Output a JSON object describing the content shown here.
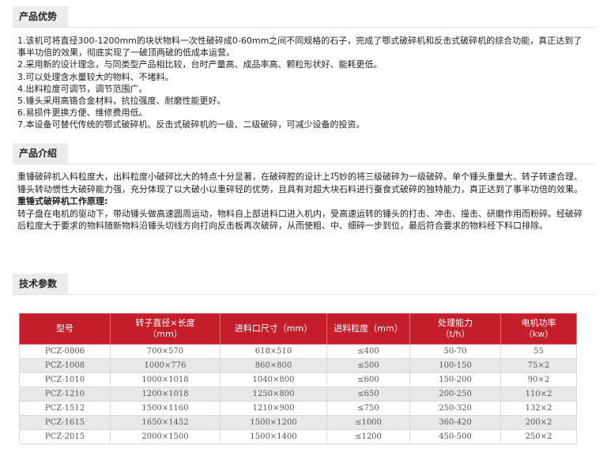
{
  "sections": {
    "advantages_title": "产品优势",
    "intro_title": "产品介绍",
    "params_title": "技术参数"
  },
  "advantages": [
    "1.该机可将直径300-1200mm的块状物料一次性破碎成0-60mm之间不同规格的石子，完成了鄂式破碎机和反击式破碎机的综合功能，真正达到了事半功倍的效果，彻底实现了一破顶两破的低成本运营。",
    "2.采用新的设计理念，与同类型产品相比较，台时产量高、成品率高、颗粒形状好、能耗更低。",
    "3.可以处理含水量较大的物料、不堵料。",
    "4.出料粒度可调节，调节范围广。",
    "5.锤头采用高铬合金材料，抗拉强度、耐磨性能更好。",
    "6.易损件更换方便、维修费用低。",
    "7.本设备可替代传统的鄂式破碎机、反击式破碎机的一级、二级破碎，可减少设备的投资。"
  ],
  "intro": {
    "para1": "重锤破碎机入料粒度大，出料粒度小破碎比大的特点十分显著，在破碎腔的设计上巧妙的将三级破碎为一级破碎。单个锤头重量大、转子转速合理、锤头转动惯性大破碎能力强，充分体现了以大破小以重碎轻的优势，且具有对超大块石料进行蚕食式破碎的独特能力，真正达到了事半功倍的效果。",
    "subtitle": "重锤式破碎机工作原理:",
    "para2": "转子盘在电机的驱动下，带动锤头做高速圆周运动，物料自上部进料口进入机内，受高速运转的锤头的打击、冲击、撞击、研磨作用而粉碎。经破碎后粒度大于要求的物料随新物料沿锤头切线方向打向反击板再次破碎，从而使粗、中、细碎一步到位，最后符合要求的物料经下料口排除。"
  },
  "table": {
    "headers": [
      "型号",
      "转子直径×长度\n（mm）",
      "进料口尺寸（mm）",
      "进料粒度（mm）",
      "处理能力\n（t/h）",
      "电机功率\n（kw）"
    ],
    "rows": [
      [
        "PCZ-0806",
        "700×570",
        "618×510",
        "≤400",
        "50-70",
        "55"
      ],
      [
        "PCZ-1008",
        "1000×776",
        "860×800",
        "≤500",
        "100-150",
        "75×2"
      ],
      [
        "PCZ-1010",
        "1000×1018",
        "1040×800",
        "≤600",
        "150-200",
        "90×2"
      ],
      [
        "PCZ-1210",
        "1200×1018",
        "1250×800",
        "≤650",
        "200-250",
        "110×2"
      ],
      [
        "PCZ-1512",
        "1500×1160",
        "1210×900",
        "≤750",
        "250-320",
        "132×2"
      ],
      [
        "PCZ-1615",
        "1650×1452",
        "1500×1200",
        "≤1000",
        "360-420",
        "200×2"
      ],
      [
        "PCZ-2015",
        "2000×1500",
        "1500×1400",
        "≤1200",
        "450-500",
        "250×2"
      ]
    ]
  }
}
